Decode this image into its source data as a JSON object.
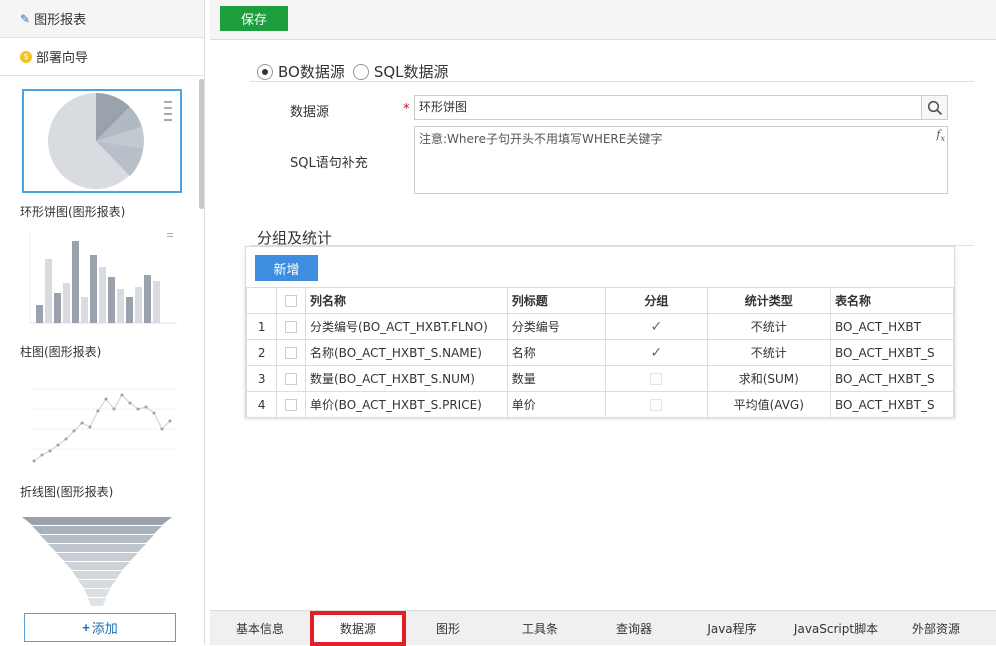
{
  "sidebar": {
    "title": "图形报表",
    "wizard": "部署向导",
    "thumbnails": [
      {
        "label": "环形饼图(图形报表)",
        "icon": "pie-chart"
      },
      {
        "label": "柱图(图形报表)",
        "icon": "bar-chart"
      },
      {
        "label": "折线图(图形报表)",
        "icon": "line-chart"
      },
      {
        "label": "",
        "icon": "funnel-chart"
      }
    ],
    "add_label": "添加"
  },
  "toolbar": {
    "save_label": "保存"
  },
  "datasource": {
    "options": [
      "BO数据源",
      "SQL数据源"
    ],
    "selected": "BO数据源",
    "ds_label": "数据源",
    "ds_value": "环形饼图",
    "sql_label": "SQL语句补充",
    "sql_placeholder": "注意:Where子句开头不用填写WHERE关键字"
  },
  "group": {
    "title": "分组及统计",
    "new_label": "新增",
    "columns": [
      "列名称",
      "列标题",
      "分组",
      "统计类型",
      "表名称"
    ],
    "rows": [
      {
        "num": "1",
        "name": "分类编号(BO_ACT_HXBT.FLNO)",
        "title": "分类编号",
        "group": true,
        "stat": "不统计",
        "table": "BO_ACT_HXBT"
      },
      {
        "num": "2",
        "name": "名称(BO_ACT_HXBT_S.NAME)",
        "title": "名称",
        "group": true,
        "stat": "不统计",
        "table": "BO_ACT_HXBT_S"
      },
      {
        "num": "3",
        "name": "数量(BO_ACT_HXBT_S.NUM)",
        "title": "数量",
        "group": false,
        "stat": "求和(SUM)",
        "table": "BO_ACT_HXBT_S"
      },
      {
        "num": "4",
        "name": "单价(BO_ACT_HXBT_S.PRICE)",
        "title": "单价",
        "group": false,
        "stat": "平均值(AVG)",
        "table": "BO_ACT_HXBT_S"
      }
    ]
  },
  "tabs": [
    "基本信息",
    "数据源",
    "图形",
    "工具条",
    "查询器",
    "Java程序",
    "JavaScript脚本",
    "外部资源"
  ],
  "active_tab": "数据源",
  "colors": {
    "save": "#1d9e3c",
    "new": "#3d8ee0",
    "active_tab_border": "#e21f26"
  }
}
